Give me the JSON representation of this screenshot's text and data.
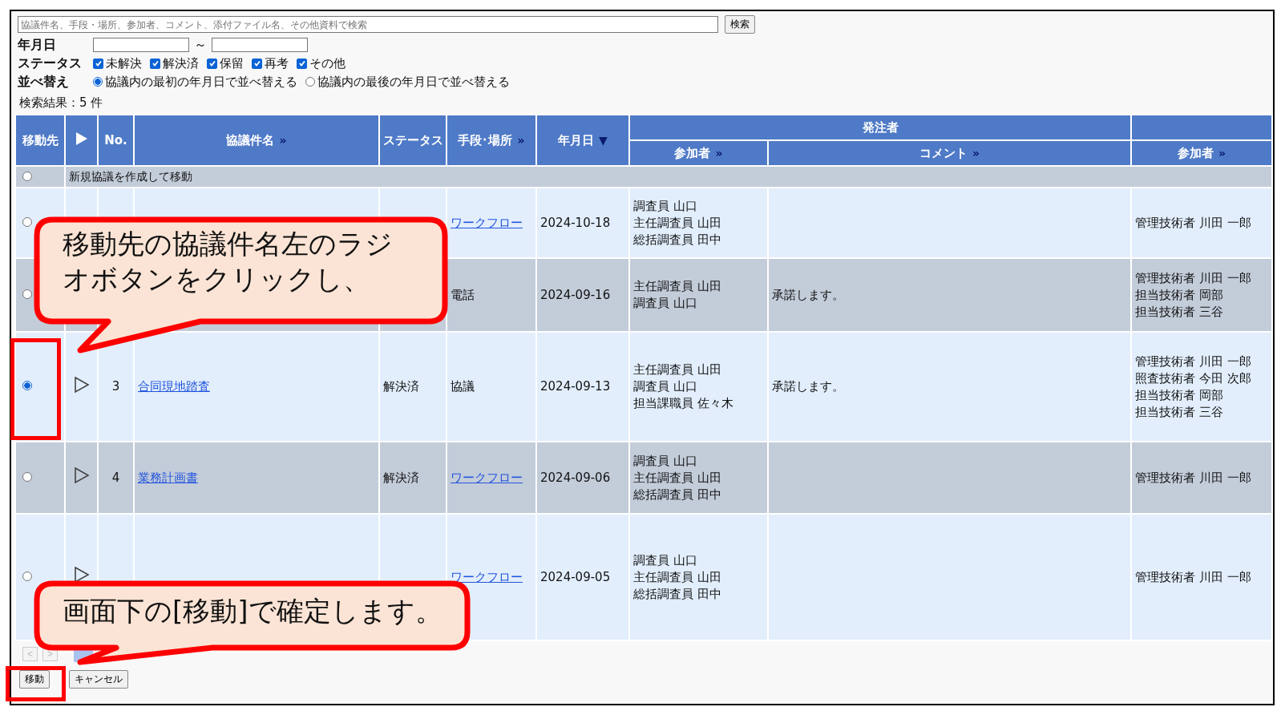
{
  "search": {
    "placeholder": "協議件名、手段・場所、参加者、コメント、添付ファイル名、その他資料で検索",
    "button": "検索"
  },
  "filters": {
    "date_label": "年月日",
    "date_separator": "～",
    "status_label": "ステータス",
    "statuses": [
      {
        "label": "未解決",
        "checked": true
      },
      {
        "label": "解決済",
        "checked": true
      },
      {
        "label": "保留",
        "checked": true
      },
      {
        "label": "再考",
        "checked": true
      },
      {
        "label": "その他",
        "checked": true
      }
    ],
    "sort_label": "並べ替え",
    "sort_options": [
      {
        "label": "協議内の最初の年月日で並べ替える",
        "selected": true
      },
      {
        "label": "協議内の最後の年月日で並べ替える",
        "selected": false
      }
    ]
  },
  "result_count": "検索結果：5 件",
  "table": {
    "columns": [
      {
        "label": "移動先"
      },
      {
        "kind": "icon"
      },
      {
        "label": "No."
      },
      {
        "label": "協議件名",
        "mark": "»"
      },
      {
        "label": "ステータス"
      },
      {
        "label": "手段･場所",
        "mark": "»"
      },
      {
        "label": "年月日",
        "mark": "▼"
      }
    ],
    "group": "発注者",
    "group_columns": [
      {
        "label": "参加者",
        "mark": "»"
      },
      {
        "label": "コメント",
        "mark": "»"
      }
    ],
    "last_column": {
      "label": "参加者",
      "mark": "»"
    },
    "new_row": {
      "selected": false,
      "label": "新規協議を作成して移動"
    },
    "rows": [
      {
        "selected": false,
        "method": {
          "text": "ワークフロー",
          "link": true
        },
        "date": "2024-10-18",
        "client_participants": [
          "調査員 山口",
          "主任調査員 山田",
          "総括調査員 田中"
        ],
        "contractor_participants": [
          "管理技術者 川田 一郎"
        ]
      },
      {
        "selected": false,
        "method": {
          "text": "電話",
          "link": false
        },
        "date": "2024-09-16",
        "client_participants": [
          "主任調査員 山田",
          "調査員 山口"
        ],
        "comment": "承諾します。",
        "contractor_participants": [
          "管理技術者 川田 一郎",
          "担当技術者 岡部",
          "担当技術者 三谷"
        ]
      },
      {
        "selected": true,
        "has_expander": true,
        "number": "3",
        "subject": "合同現地踏査",
        "status": "解決済",
        "method": {
          "text": "協議",
          "link": false
        },
        "date": "2024-09-13",
        "client_participants": [
          "主任調査員 山田",
          "調査員 山口",
          "担当課職員 佐々木"
        ],
        "comment": "承諾します。",
        "contractor_participants": [
          "管理技術者 川田 一郎",
          "照査技術者 今田 次郎",
          "担当技術者 岡部",
          "担当技術者 三谷"
        ]
      },
      {
        "selected": false,
        "has_expander": true,
        "number": "4",
        "subject": "業務計画書",
        "status": "解決済",
        "method": {
          "text": "ワークフロー",
          "link": true
        },
        "date": "2024-09-06",
        "client_participants": [
          "調査員 山口",
          "主任調査員 山田",
          "総括調査員 田中"
        ],
        "contractor_participants": [
          "管理技術者 川田 一郎"
        ]
      },
      {
        "selected": false,
        "has_expander": true,
        "method": {
          "text": "ワークフロー",
          "link": true
        },
        "date": "2024-09-05",
        "client_participants": [
          "調査員 山口",
          "主任調査員 山田",
          "総括調査員 田中"
        ],
        "contractor_participants": [
          "管理技術者 川田 一郎"
        ]
      }
    ]
  },
  "pager": {
    "prev": "<",
    "next": ">"
  },
  "buttons": [
    {
      "label": "移動"
    },
    {
      "label": "キャンセル"
    }
  ],
  "callouts": [
    {
      "text": "移動先の協議件名左のラジオボタンをクリックし、"
    },
    {
      "text": "画面下の[移動]で確定します。"
    }
  ]
}
